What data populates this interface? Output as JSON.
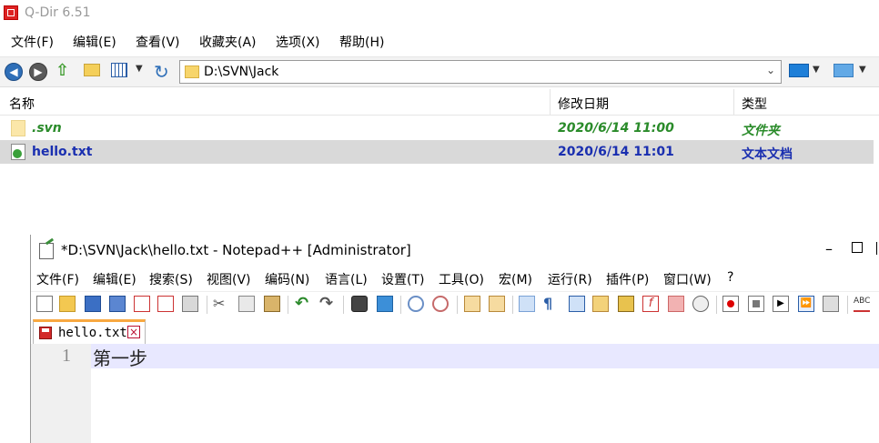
{
  "qdir": {
    "title": "Q-Dir 6.51",
    "menu": [
      "文件(F)",
      "编辑(E)",
      "查看(V)",
      "收藏夹(A)",
      "选项(X)",
      "帮助(H)"
    ],
    "address": "D:\\SVN\\Jack",
    "columns": {
      "name": "名称",
      "modified": "修改日期",
      "type": "类型"
    },
    "files": [
      {
        "name": ".svn",
        "modified": "2020/6/14 11:00",
        "type": "文件夹",
        "icon": "folder-icon"
      },
      {
        "name": "hello.txt",
        "modified": "2020/6/14 11:01",
        "type": "文本文档",
        "icon": "svn-text-file-icon",
        "selected": true
      }
    ]
  },
  "npp": {
    "title": "*D:\\SVN\\Jack\\hello.txt - Notepad++ [Administrator]",
    "menu": [
      "文件(F)",
      "编辑(E)",
      "搜索(S)",
      "视图(V)",
      "编码(N)",
      "语言(L)",
      "设置(T)",
      "工具(O)",
      "宏(M)",
      "运行(R)",
      "插件(P)",
      "窗口(W)",
      "?"
    ],
    "tab": {
      "label": "hello.txt",
      "close_symbol": "×"
    },
    "editor": {
      "line_number": "1",
      "text": "第一步"
    },
    "window_controls": {
      "minimize_symbol": "–"
    }
  },
  "colors": {
    "selection": "#d9d9d9",
    "svn_green": "#2a8b2a",
    "file_blue": "#1a2fb0",
    "tab_accent": "#f8a840",
    "current_line": "#e8e8ff"
  }
}
